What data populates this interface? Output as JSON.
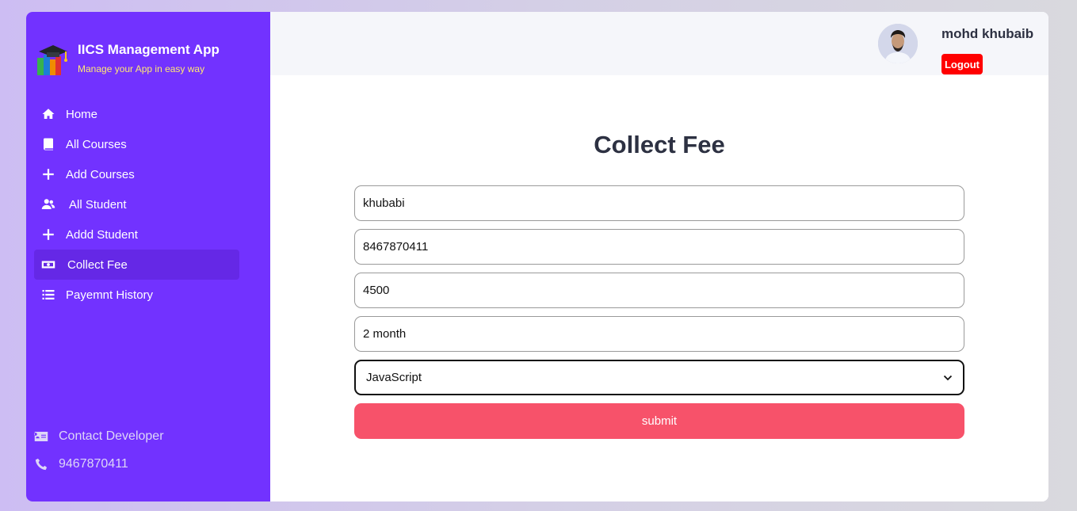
{
  "brand": {
    "title": "IICS Management App",
    "subtitle": "Manage your App in easy way"
  },
  "sidebar": {
    "items": [
      {
        "label": "Home",
        "icon": "home-icon"
      },
      {
        "label": "All Courses",
        "icon": "book-icon"
      },
      {
        "label": "Add Courses",
        "icon": "plus-icon"
      },
      {
        "label": "All Student",
        "icon": "users-icon"
      },
      {
        "label": "Addd Student",
        "icon": "plus-icon"
      },
      {
        "label": "Collect Fee",
        "icon": "money-icon",
        "active": true
      },
      {
        "label": "Payemnt History",
        "icon": "list-icon"
      }
    ],
    "contact_label": "Contact Developer",
    "contact_phone": "9467870411"
  },
  "header": {
    "user_name": "mohd khubaib",
    "logout_label": "Logout"
  },
  "page": {
    "title": "Collect Fee",
    "fields": {
      "name": "khubabi",
      "phone": "8467870411",
      "amount": "4500",
      "remark": "2 month"
    },
    "course_selected": "JavaScript",
    "submit_label": "submit"
  },
  "colors": {
    "sidebar": "#7232ff",
    "brand_subtitle": "#ffe873",
    "logout": "#ff0000",
    "submit": "#f7526a"
  }
}
